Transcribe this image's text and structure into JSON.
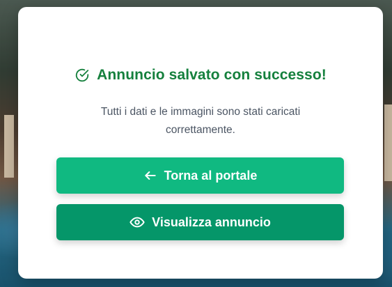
{
  "dialog": {
    "title": "Annuncio salvato con successo!",
    "message": "Tutti i dati e le immagini sono stati caricati correttamente.",
    "icon": "check-circle-icon"
  },
  "actions": {
    "back_label": "Torna al portale",
    "back_icon": "arrow-left-icon",
    "view_label": "Visualizza annuncio",
    "view_icon": "eye-icon"
  },
  "colors": {
    "success_text": "#15803d",
    "primary_button": "#10b981",
    "secondary_button": "#059669"
  }
}
